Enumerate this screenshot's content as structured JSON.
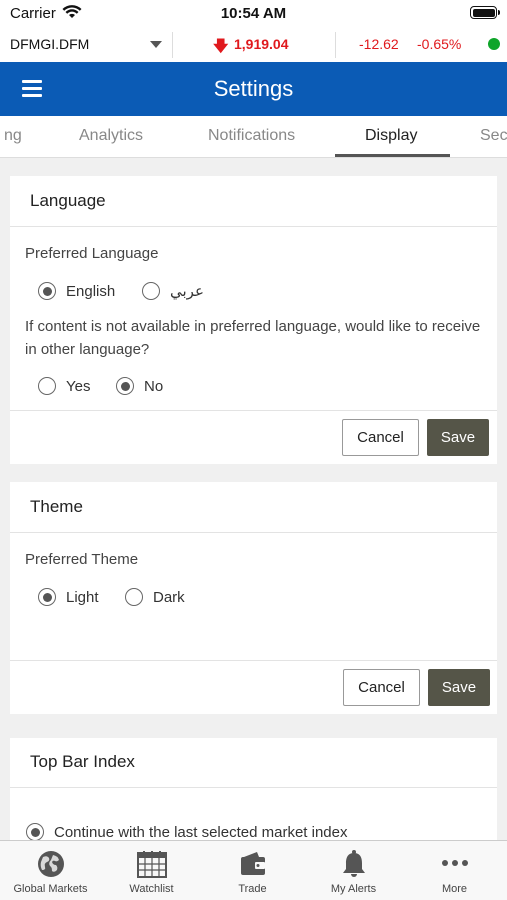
{
  "status_bar": {
    "carrier": "Carrier",
    "time": "10:54 AM"
  },
  "index_bar": {
    "name": "DFMGI.DFM",
    "value": "1,919.04",
    "change": "-12.62",
    "percent": "-0.65%",
    "trend": "down",
    "colors": {
      "negative": "#e0191d",
      "market_status": "#0fa52a"
    }
  },
  "header": {
    "title": "Settings",
    "accent_color": "#0b5bb5"
  },
  "tabs": [
    {
      "label": "ng",
      "active": false
    },
    {
      "label": "Analytics",
      "active": false
    },
    {
      "label": "Notifications",
      "active": false
    },
    {
      "label": "Display",
      "active": true
    },
    {
      "label": "Sec",
      "active": false
    }
  ],
  "language_card": {
    "title": "Language",
    "preferred_label": "Preferred Language",
    "options": [
      {
        "label": "English",
        "selected": true
      },
      {
        "label": "عربي",
        "selected": false
      }
    ],
    "fallback_question": "If content is not available in preferred language, would like to receive in other language?",
    "fallback_options": [
      {
        "label": "Yes",
        "selected": false
      },
      {
        "label": "No",
        "selected": true
      }
    ],
    "cancel_label": "Cancel",
    "save_label": "Save"
  },
  "theme_card": {
    "title": "Theme",
    "preferred_label": "Preferred Theme",
    "options": [
      {
        "label": "Light",
        "selected": true
      },
      {
        "label": "Dark",
        "selected": false
      }
    ],
    "cancel_label": "Cancel",
    "save_label": "Save"
  },
  "top_bar_card": {
    "title": "Top Bar Index",
    "option_label": "Continue with the last selected market index"
  },
  "tab_bar": [
    {
      "label": "Global Markets",
      "icon": "globe-icon"
    },
    {
      "label": "Watchlist",
      "icon": "calendar-grid-icon"
    },
    {
      "label": "Trade",
      "icon": "wallet-icon"
    },
    {
      "label": "My Alerts",
      "icon": "bell-icon"
    },
    {
      "label": "More",
      "icon": "more-dots-icon"
    }
  ]
}
